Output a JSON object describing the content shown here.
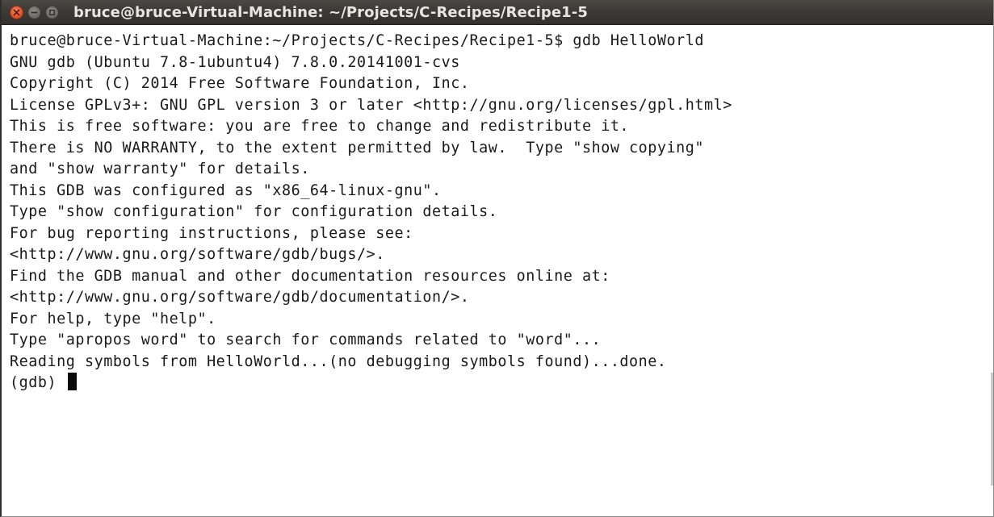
{
  "window": {
    "title": "bruce@bruce-Virtual-Machine: ~/Projects/C-Recipes/Recipe1-5"
  },
  "terminal": {
    "lines": [
      "bruce@bruce-Virtual-Machine:~/Projects/C-Recipes/Recipe1-5$ gdb HelloWorld",
      "GNU gdb (Ubuntu 7.8-1ubuntu4) 7.8.0.20141001-cvs",
      "Copyright (C) 2014 Free Software Foundation, Inc.",
      "License GPLv3+: GNU GPL version 3 or later <http://gnu.org/licenses/gpl.html>",
      "This is free software: you are free to change and redistribute it.",
      "There is NO WARRANTY, to the extent permitted by law.  Type \"show copying\"",
      "and \"show warranty\" for details.",
      "This GDB was configured as \"x86_64-linux-gnu\".",
      "Type \"show configuration\" for configuration details.",
      "For bug reporting instructions, please see:",
      "<http://www.gnu.org/software/gdb/bugs/>.",
      "Find the GDB manual and other documentation resources online at:",
      "<http://www.gnu.org/software/gdb/documentation/>.",
      "For help, type \"help\".",
      "Type \"apropos word\" to search for commands related to \"word\"...",
      "Reading symbols from HelloWorld...(no debugging symbols found)...done."
    ],
    "prompt": "(gdb) "
  },
  "icons": {
    "close": "close-icon",
    "minimize": "minimize-icon",
    "maximize": "maximize-icon"
  },
  "colors": {
    "titlebar": "#3c3b37",
    "close_button": "#e2542c",
    "terminal_bg": "#ffffff",
    "terminal_text": "#1a1a1a"
  }
}
